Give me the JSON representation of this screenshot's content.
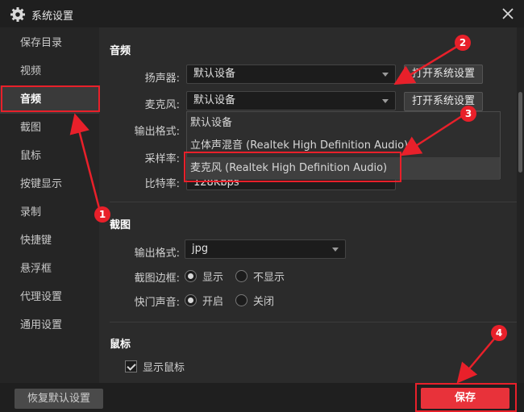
{
  "window": {
    "title": "系统设置"
  },
  "sidebar": {
    "items": [
      {
        "label": "保存目录"
      },
      {
        "label": "视频"
      },
      {
        "label": "音频",
        "active": true
      },
      {
        "label": "截图"
      },
      {
        "label": "鼠标"
      },
      {
        "label": "按键显示"
      },
      {
        "label": "录制"
      },
      {
        "label": "快捷键"
      },
      {
        "label": "悬浮框"
      },
      {
        "label": "代理设置"
      },
      {
        "label": "通用设置"
      }
    ]
  },
  "audio": {
    "title": "音频",
    "speaker_label": "扬声器:",
    "speaker_value": "默认设备",
    "speaker_btn": "打开系统设置",
    "mic_label": "麦克风:",
    "mic_value": "默认设备",
    "mic_btn": "打开系统设置",
    "format_label": "输出格式:",
    "samplerate_label": "采样率:",
    "bitrate_label": "比特率:",
    "bitrate_value": "128Kbps",
    "mic_options": [
      "默认设备",
      "立体声混音 (Realtek High Definition Audio)",
      "麦克风 (Realtek High Definition Audio)"
    ]
  },
  "screenshot": {
    "title": "截图",
    "format_label": "输出格式:",
    "format_value": "jpg",
    "border_label": "截图边框:",
    "border_show": "显示",
    "border_hide": "不显示",
    "shutter_label": "快门声音:",
    "shutter_on": "开启",
    "shutter_off": "关闭"
  },
  "mouse": {
    "title": "鼠标",
    "show_cursor": "显示鼠标"
  },
  "footer": {
    "reset": "恢复默认设置",
    "save": "保存"
  },
  "annotations": {
    "badge1": "1",
    "badge2": "2",
    "badge3": "3",
    "badge4": "4",
    "color": "#e8202a"
  }
}
